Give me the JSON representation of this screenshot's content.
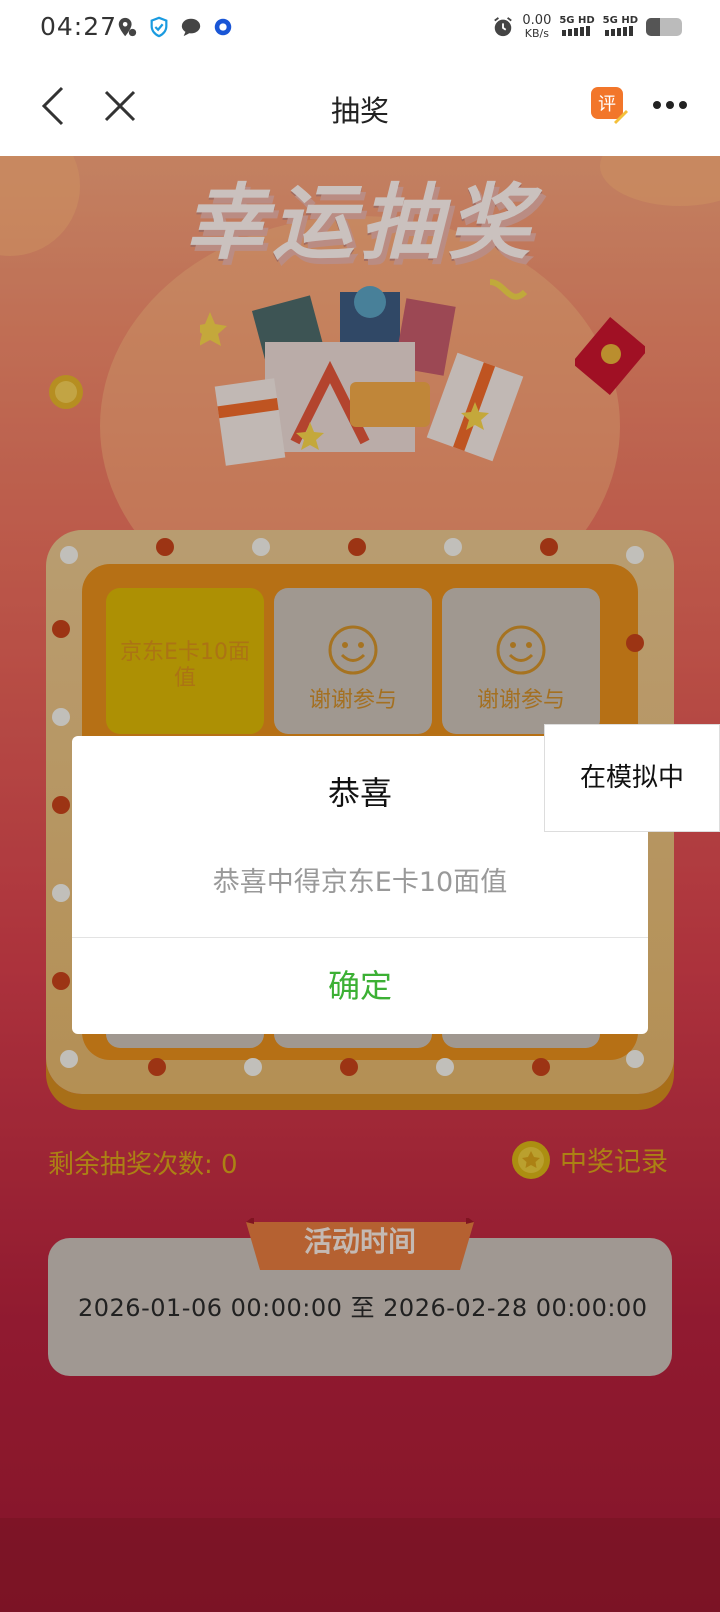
{
  "status_bar": {
    "time": "04:27",
    "speed_value": "0.00",
    "speed_unit": "KB/s",
    "signal_1": "5G HD",
    "signal_2": "5G HD",
    "battery_level": 0.4,
    "icons": [
      "location-icon",
      "verified-icon",
      "chat-icon",
      "app-icon",
      "alarm-icon"
    ]
  },
  "nav": {
    "title": "抽奖",
    "eval_badge": "评"
  },
  "banner": {
    "title": "幸运抽奖"
  },
  "grid": {
    "cells": [
      {
        "label": "京东E卡10面值",
        "active": true
      },
      {
        "label": "谢谢参与",
        "active": false
      },
      {
        "label": "谢谢参与",
        "active": false
      }
    ]
  },
  "remaining": "剩余抽奖次数: 0",
  "record_label": "中奖记录",
  "activity": {
    "heading": "活动时间",
    "range": "2026-01-06 00:00:00  至  2026-02-28 00:00:00"
  },
  "dialog": {
    "title": "恭喜",
    "message": "恭喜中得京东E卡10面值",
    "ok_label": "确定"
  },
  "sim_toast": "在模拟中",
  "colors": {
    "accent_green": "#3cb034",
    "gold_text": "#d8a21a",
    "board_orange": "#e48c1b"
  }
}
